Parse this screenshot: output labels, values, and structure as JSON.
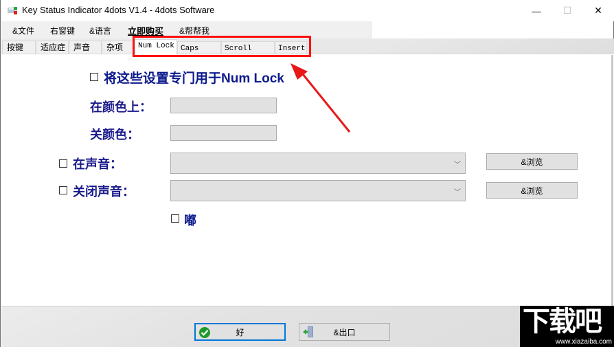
{
  "window": {
    "title": "Key Status Indicator 4dots V1.4 - 4dots Software",
    "icon": "keyboard-app-icon",
    "controls": {
      "minimize": "—",
      "maximize": "☐",
      "close": "✕"
    }
  },
  "menu": {
    "items": [
      {
        "label": "&文件"
      },
      {
        "label": "右窗键"
      },
      {
        "label": "&语言"
      },
      {
        "label": "立即购买"
      },
      {
        "label": "&帮帮我"
      }
    ]
  },
  "tabs": [
    {
      "label": "按键",
      "active": false
    },
    {
      "label": "适应症",
      "active": false
    },
    {
      "label": "声音",
      "active": false
    },
    {
      "label": "杂项",
      "active": false
    },
    {
      "label": "Num Lock",
      "active": true
    },
    {
      "label": "Caps Lock",
      "active": false
    },
    {
      "label": "Scroll Lock",
      "active": false
    },
    {
      "label": "Insert",
      "active": false
    }
  ],
  "form": {
    "dedicate_checkbox": {
      "label": "将这些设置专门用于Num Lock",
      "checked": false
    },
    "on_color": {
      "label": "在颜色上：",
      "value": ""
    },
    "off_color": {
      "label": "关颜色：",
      "value": ""
    },
    "on_sound": {
      "label": "在声音：",
      "checked": false,
      "value": "",
      "browse_label": "&浏览"
    },
    "off_sound": {
      "label": "关闭声音：",
      "checked": false,
      "value": "",
      "browse_label": "&浏览"
    },
    "beep": {
      "label": "嘟",
      "checked": false
    }
  },
  "footer": {
    "ok_label": "好",
    "exit_label": "&出口"
  },
  "annotation": {
    "highlight_color": "#ff1010",
    "arrow_color": "#e81818"
  },
  "watermark": {
    "main": "下载吧",
    "url": "www.xiazaiba.com"
  }
}
